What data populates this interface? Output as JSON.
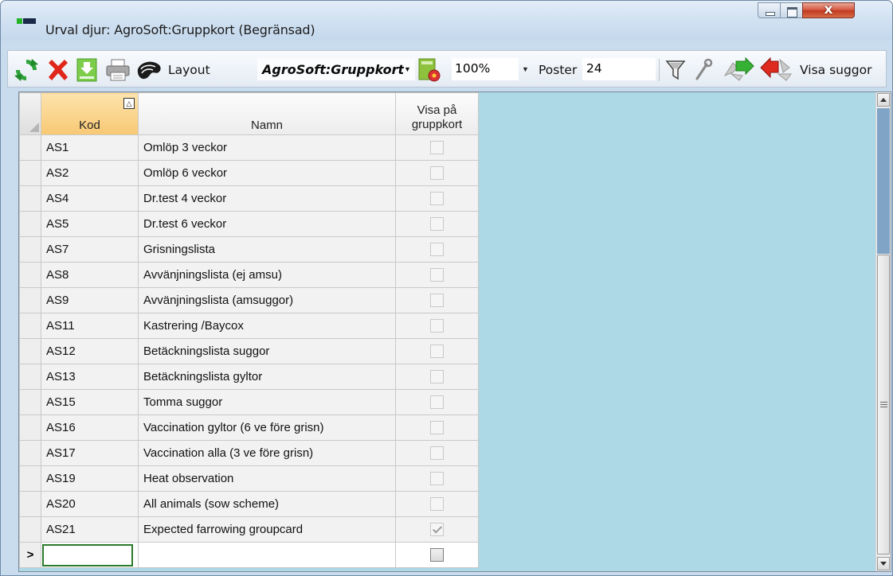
{
  "window": {
    "title": "Urval djur: AgroSoft:Gruppkort (Begränsad)",
    "close_glyph": "x"
  },
  "toolbar": {
    "layout_label": "Layout",
    "layout_value": "AgroSoft:Gruppkort",
    "zoom_value": "100%",
    "poster_label": "Poster",
    "poster_count": "24",
    "visa_suggor_label": "Visa suggor",
    "icons": [
      "refresh-icon",
      "delete-icon",
      "save-icon",
      "print-icon",
      "fingerprint-icon",
      "layout-settings-icon",
      "filter-icon",
      "wrench-icon",
      "green-arrows-icon",
      "red-arrows-icon"
    ]
  },
  "grid": {
    "columns": {
      "kod": "Kod",
      "namn": "Namn",
      "visa_line1": "Visa på",
      "visa_line2": "gruppkort"
    },
    "sort_glyph": "△",
    "new_row_marker": ">",
    "rows": [
      {
        "kod": "AS1",
        "namn": "Omlöp 3 veckor",
        "checked": false
      },
      {
        "kod": "AS2",
        "namn": "Omlöp 6 veckor",
        "checked": false
      },
      {
        "kod": "AS4",
        "namn": "Dr.test 4 veckor",
        "checked": false
      },
      {
        "kod": "AS5",
        "namn": "Dr.test 6 veckor",
        "checked": false
      },
      {
        "kod": "AS7",
        "namn": "Grisningslista",
        "checked": false
      },
      {
        "kod": "AS8",
        "namn": "Avvänjningslista (ej amsu)",
        "checked": false
      },
      {
        "kod": "AS9",
        "namn": "Avvänjningslista (amsuggor)",
        "checked": false
      },
      {
        "kod": "AS11",
        "namn": "Kastrering /Baycox",
        "checked": false
      },
      {
        "kod": "AS12",
        "namn": "Betäckningslista suggor",
        "checked": false
      },
      {
        "kod": "AS13",
        "namn": "Betäckningslista gyltor",
        "checked": false
      },
      {
        "kod": "AS15",
        "namn": "Tomma suggor",
        "checked": false
      },
      {
        "kod": "AS16",
        "namn": "Vaccination gyltor (6 ve före grisn)",
        "checked": false
      },
      {
        "kod": "AS17",
        "namn": "Vaccination alla (3 ve före grisn)",
        "checked": false
      },
      {
        "kod": "AS19",
        "namn": "Heat observation",
        "checked": false
      },
      {
        "kod": "AS20",
        "namn": "All animals (sow scheme)",
        "checked": false
      },
      {
        "kod": "AS21",
        "namn": "Expected farrowing groupcard",
        "checked": true
      }
    ]
  },
  "colors": {
    "grid_background": "#add8e6",
    "sorted_header": "#f8c874",
    "new_row_border": "#2c7a2c"
  }
}
